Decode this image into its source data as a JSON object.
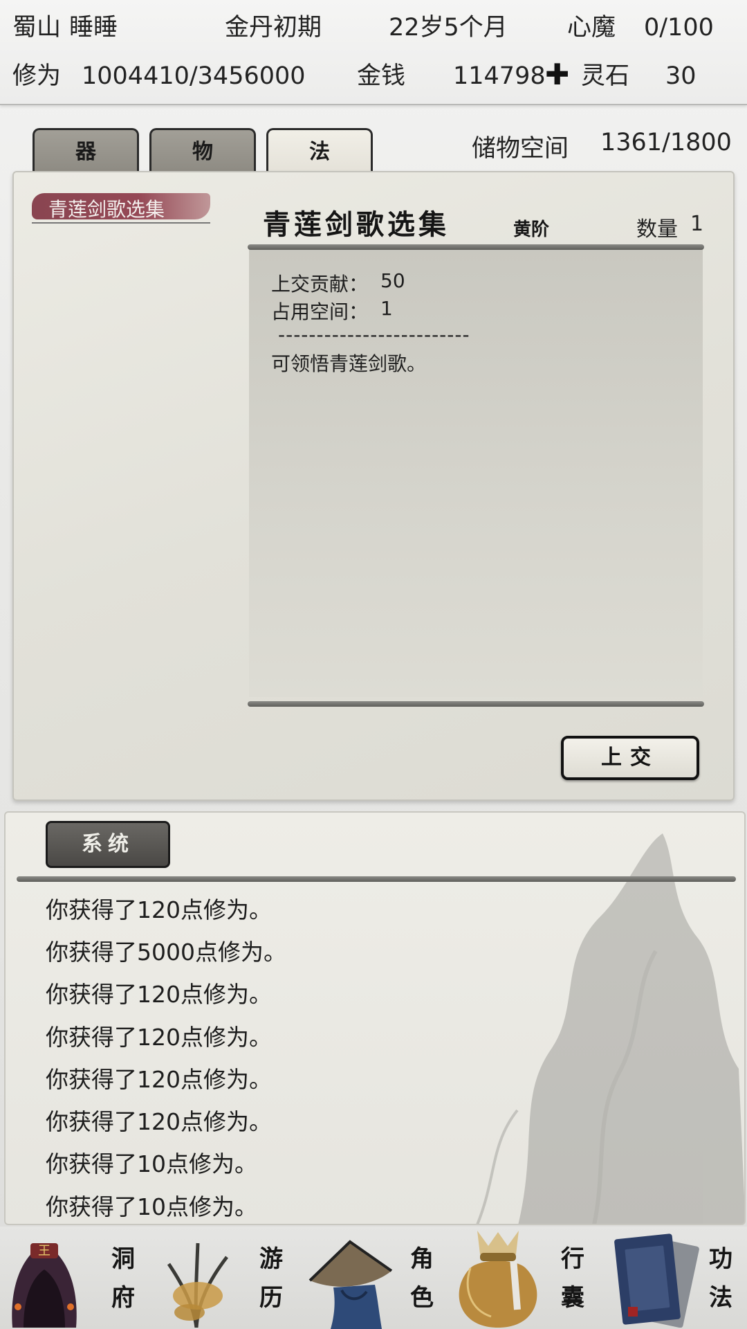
{
  "status": {
    "sect": "蜀山",
    "name": "睡睡",
    "realm": "金丹初期",
    "age": "22岁5个月",
    "demon_label": "心魔",
    "demon_value": "0/100",
    "cultivation_label": "修为",
    "cultivation_value": "1004410/3456000",
    "money_label": "金钱",
    "money_value": "114798",
    "spirit_stone_label": "灵石",
    "spirit_stone_value": "30"
  },
  "tabs": [
    {
      "label": "器",
      "active": false
    },
    {
      "label": "物",
      "active": false
    },
    {
      "label": "法",
      "active": true
    }
  ],
  "storage": {
    "label": "储物空间",
    "value": "1361/1800"
  },
  "item_list": [
    {
      "name": "青莲剑歌选集",
      "selected": true
    }
  ],
  "detail": {
    "title": "青莲剑歌选集",
    "grade": "黄阶",
    "quantity_label": "数量",
    "quantity_value": "1",
    "contribution_label": "上交贡献：",
    "contribution_value": "50",
    "space_label": "占用空间：",
    "space_value": "1",
    "separator": "-------------------------",
    "description": "可领悟青莲剑歌。",
    "submit_label": "上交"
  },
  "log": {
    "tab_label": "系统",
    "messages": [
      "你获得了120点修为。",
      "你获得了5000点修为。",
      "你获得了120点修为。",
      "你获得了120点修为。",
      "你获得了120点修为。",
      "你获得了120点修为。",
      "你获得了10点修为。",
      "你获得了10点修为。"
    ]
  },
  "nav": [
    {
      "label_top": "洞",
      "label_bottom": "府",
      "icon": "cave-dwelling-icon"
    },
    {
      "label_top": "游",
      "label_bottom": "历",
      "icon": "travel-icon"
    },
    {
      "label_top": "角",
      "label_bottom": "色",
      "icon": "character-icon"
    },
    {
      "label_top": "行",
      "label_bottom": "囊",
      "icon": "bag-icon"
    },
    {
      "label_top": "功",
      "label_bottom": "法",
      "icon": "scroll-book-icon"
    }
  ],
  "colors": {
    "accent_brush": "#8c3746",
    "panel_bg": "#e6e5dd",
    "tab_inactive": "#8d8a82",
    "tab_active": "#ebe9e0"
  }
}
